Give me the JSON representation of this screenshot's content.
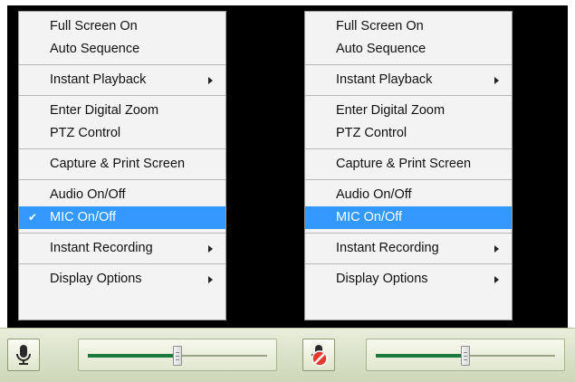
{
  "menus": [
    {
      "groups": [
        [
          {
            "label": "Full Screen On"
          },
          {
            "label": "Auto Sequence"
          }
        ],
        [
          {
            "label": "Instant Playback",
            "submenu": true
          }
        ],
        [
          {
            "label": "Enter Digital Zoom"
          },
          {
            "label": "PTZ Control"
          }
        ],
        [
          {
            "label": "Capture & Print Screen"
          }
        ],
        [
          {
            "label": "Audio On/Off"
          },
          {
            "label": "MIC On/Off",
            "checked": true,
            "selected": true
          }
        ],
        [
          {
            "label": "Instant Recording",
            "submenu": true
          }
        ],
        [
          {
            "label": "Display Options",
            "submenu": true
          }
        ]
      ]
    },
    {
      "groups": [
        [
          {
            "label": "Full Screen On"
          },
          {
            "label": "Auto Sequence"
          }
        ],
        [
          {
            "label": "Instant Playback",
            "submenu": true
          }
        ],
        [
          {
            "label": "Enter Digital Zoom"
          },
          {
            "label": "PTZ Control"
          }
        ],
        [
          {
            "label": "Capture & Print Screen"
          }
        ],
        [
          {
            "label": "Audio On/Off"
          },
          {
            "label": "MIC On/Off",
            "checked": false,
            "selected": true
          }
        ],
        [
          {
            "label": "Instant Recording",
            "submenu": true
          }
        ],
        [
          {
            "label": "Display Options",
            "submenu": true
          }
        ]
      ]
    }
  ],
  "check_glyph": "✔",
  "controls": [
    {
      "mic_icon": "microphone-icon",
      "muted": false,
      "volume_fraction": 0.5
    },
    {
      "mic_icon": "microphone-muted-icon",
      "muted": true,
      "volume_fraction": 0.5
    }
  ],
  "colors": {
    "selection": "#3399ff",
    "slider_fill": "#1d7a3e",
    "mute_badge": "#e23b2e"
  }
}
